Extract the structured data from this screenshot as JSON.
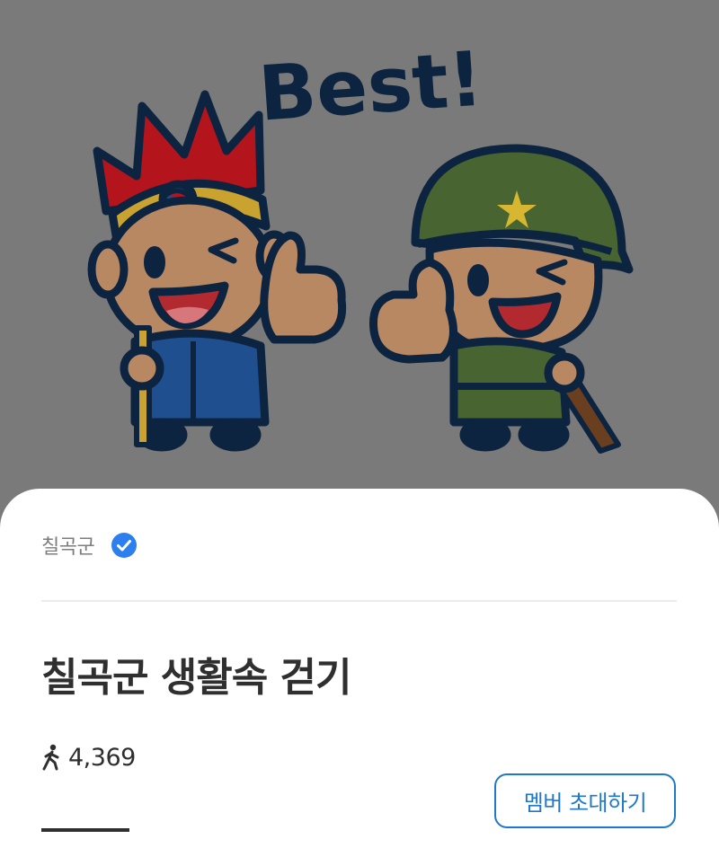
{
  "hero": {
    "image_alt_icon": "mascot-thumbs-up-illustration",
    "best_text": "Best!",
    "colors": {
      "background": "#7a7a7a",
      "outline": "#0c2440"
    }
  },
  "group": {
    "name": "칠곡군",
    "verified_icon": "check-badge-icon",
    "title": "칠곡군 생활속 걷기"
  },
  "stats": {
    "steps_icon": "walking-person-icon",
    "steps": "4,369"
  },
  "actions": {
    "invite_label": "멤버 초대하기"
  },
  "colors": {
    "accent": "#1f78c9",
    "badge": "#2d7ff0",
    "title_text": "#2f2f2f",
    "muted_text": "#7d7d7d"
  }
}
